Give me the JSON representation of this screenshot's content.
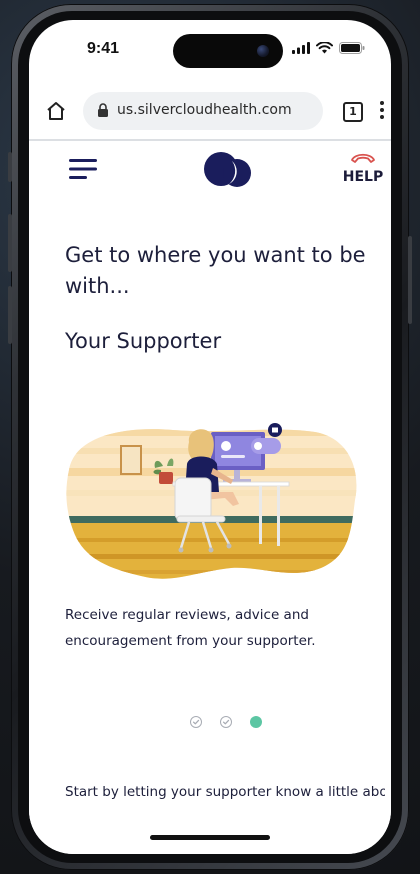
{
  "status_bar": {
    "time": "9:41"
  },
  "browser": {
    "url": "us.silvercloudhealth.com",
    "tab_count": "1"
  },
  "header": {
    "help_label": "HELP"
  },
  "onboarding": {
    "headline": "Get to where you want to be with...",
    "subheading": "Your Supporter",
    "description": "Receive regular reviews, advice and encouragement from your supporter.",
    "footer": "Start by letting your supporter know a little about",
    "steps": [
      {
        "state": "completed"
      },
      {
        "state": "completed"
      },
      {
        "state": "active"
      }
    ]
  },
  "colors": {
    "brand_navy": "#1a1d5c",
    "text": "#1d1f3b",
    "accent_green": "#5cc6a3",
    "help_phone_red": "#d9534f",
    "illustration_ochre": "#e3b23c",
    "illustration_teal": "#3f6b5f",
    "illustration_purple": "#6a5fc4"
  },
  "icons": {
    "home": "home-icon",
    "lock": "lock-icon",
    "tabs": "tab-switcher-icon",
    "more": "more-vertical-icon",
    "menu": "hamburger-menu-icon",
    "help": "phone-hangup-icon",
    "signal": "signal-icon",
    "wifi": "wifi-icon",
    "battery": "battery-icon"
  }
}
